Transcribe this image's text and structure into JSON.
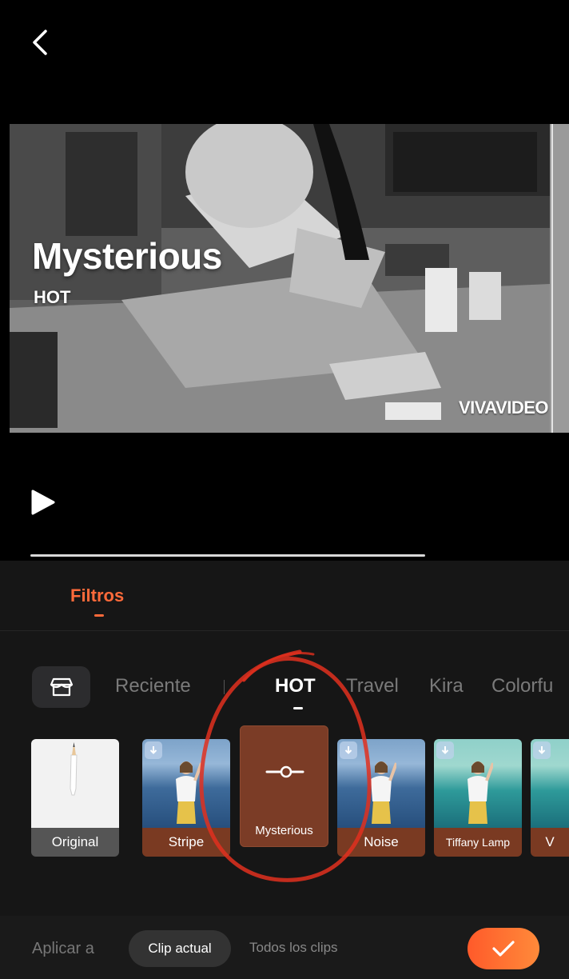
{
  "preview": {
    "filter_title": "Mysterious",
    "filter_subtitle": "HOT",
    "watermark": "VIVAVIDEO",
    "progress": 1.0
  },
  "panel": {
    "tab_label": "Filtros",
    "categories": [
      "Reciente",
      "HOT",
      "Travel",
      "Kira",
      "Colorfu"
    ],
    "active_category": "HOT",
    "filters": [
      {
        "label": "Original"
      },
      {
        "label": "Stripe"
      },
      {
        "label": "Mysterious",
        "selected": true
      },
      {
        "label": "Noise"
      },
      {
        "label": "Tiffany Lamp"
      },
      {
        "label": "V"
      }
    ]
  },
  "bottom": {
    "apply_label": "Aplicar a",
    "current_clip": "Clip actual",
    "all_clips": "Todos los clips"
  },
  "colors": {
    "accent": "#ff6a3a",
    "selected_tile": "#7b3c26",
    "annotation": "#e0301e"
  },
  "icons": [
    "chevron-left-icon",
    "play-icon",
    "store-icon",
    "adjust-slider-icon",
    "download-icon",
    "checkmark-icon"
  ]
}
